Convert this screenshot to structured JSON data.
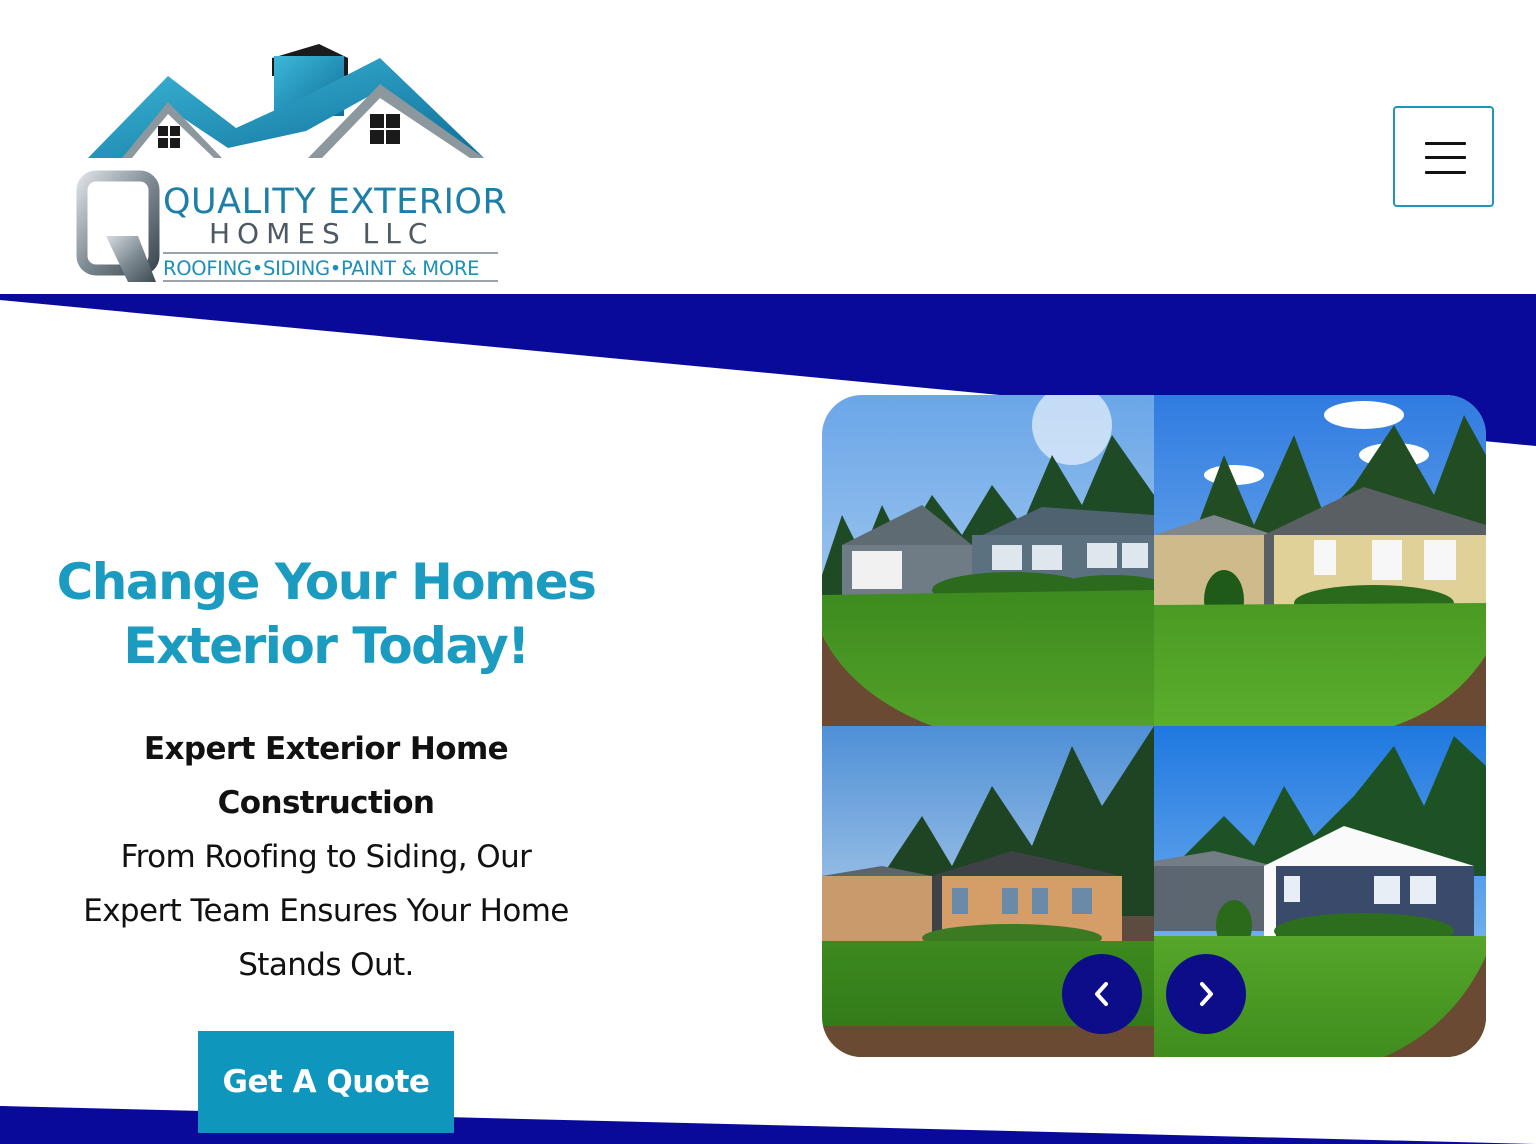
{
  "header": {
    "logo": {
      "line1": "QUALITY EXTERIOR",
      "line2": "HOMES LLC",
      "line3": "ROOFING•SIDING•PAINT & MORE",
      "icon": "house-roof-logo-icon"
    },
    "menu_icon": "hamburger-menu-icon"
  },
  "hero": {
    "headline_line1": "Change Your Homes",
    "headline_line2": "Exterior Today!",
    "subheading_line1": "Expert Exterior Home",
    "subheading_line2": "Construction",
    "body_line1": "From Roofing to Siding, Our",
    "body_line2": "Expert Team Ensures Your Home",
    "body_line3": "Stands Out.",
    "cta_label": "Get A Quote"
  },
  "gallery": {
    "photos": [
      "house-photo-gray",
      "house-photo-yellow",
      "house-photo-bare-plywood",
      "house-photo-blue"
    ],
    "prev_icon": "chevron-left-icon",
    "next_icon": "chevron-right-icon"
  },
  "colors": {
    "brand_navy": "#0a0a9a",
    "brand_teal": "#1c9bc0",
    "button_teal": "#0e96bd",
    "nav_button": "#0d0d8a"
  }
}
